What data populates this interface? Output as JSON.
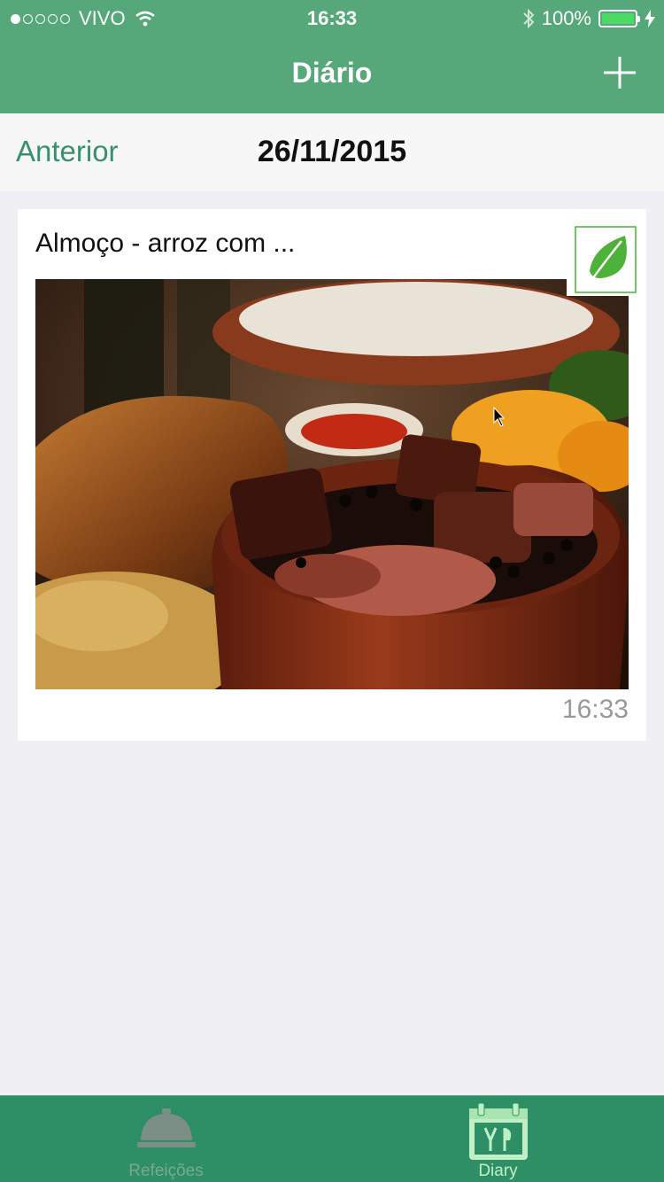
{
  "status_bar": {
    "carrier": "VIVO",
    "time": "16:33",
    "battery_percent": "100%",
    "signal_bars_filled": 1,
    "signal_bars_total": 5
  },
  "nav": {
    "title": "Diário",
    "add_icon": "plus-icon"
  },
  "date_bar": {
    "previous_label": "Anterior",
    "date": "26/11/2015"
  },
  "entries": [
    {
      "title": "Almoço - arroz com ...",
      "time": "16:33",
      "badge_icon": "leaf-icon"
    }
  ],
  "tab_bar": {
    "tabs": [
      {
        "label": "Refeições",
        "icon": "cloche-icon",
        "selected": false
      },
      {
        "label": "Diary",
        "icon": "calendar-cutlery-icon",
        "selected": true
      }
    ]
  },
  "colors": {
    "nav_green": "#56a87a",
    "tab_green": "#2e8f67",
    "accent_text": "#3a8f6c",
    "leaf_green": "#4db13a",
    "battery_green": "#4cd964"
  }
}
